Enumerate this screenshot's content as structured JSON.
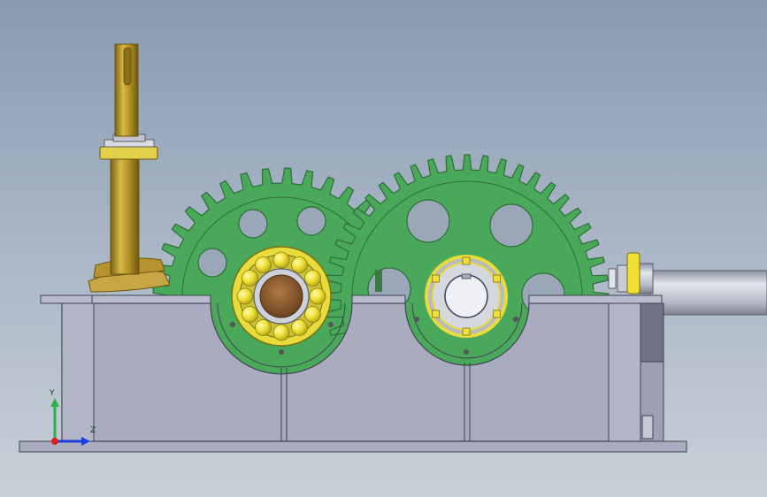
{
  "viewport": {
    "background_top": "#8a9bb0",
    "background_bottom": "#c9d0d9"
  },
  "colors": {
    "gear": "#4aa85a",
    "gear_edge": "#2e6e38",
    "housing": "#a9acbf",
    "housing_edge": "#3f4250",
    "shaft_gold": "#b8982a",
    "shaft_edge": "#6a5510",
    "bearing_ring": "#e8dc3c",
    "bearing_ball": "#f0e23a",
    "bore": "#8b5a2b",
    "output_shaft": "#b9bcc8"
  },
  "triad": {
    "axis_y_label": "Y",
    "axis_z_label": "Z",
    "axis_y_color": "#2bb24c",
    "axis_z_color": "#1d3ed8",
    "axis_x_color": "#d81f1f"
  }
}
